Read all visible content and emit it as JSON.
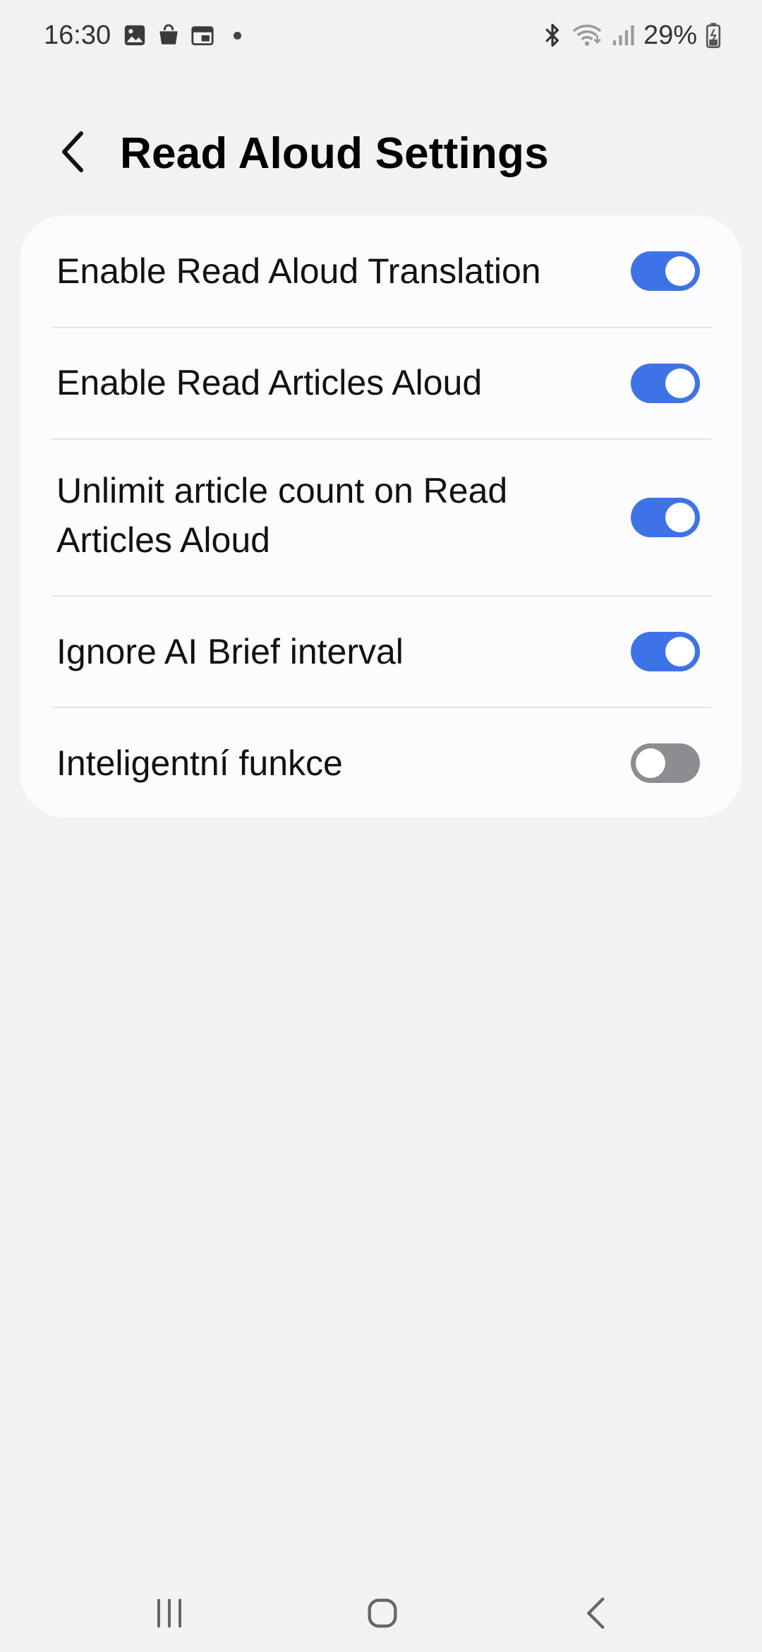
{
  "status_bar": {
    "time": "16:30",
    "battery_percent": "29%",
    "left_icons": [
      "gallery-icon",
      "shopping-bag-icon",
      "calendar-icon",
      "notification-dot-icon"
    ],
    "right_icons": [
      "bluetooth-icon",
      "wifi-icon",
      "signal-icon",
      "battery-charging-icon"
    ]
  },
  "header": {
    "title": "Read Aloud Settings",
    "back_icon": "chevron-left-icon"
  },
  "settings": [
    {
      "label": "Enable Read Aloud Translation",
      "enabled": true
    },
    {
      "label": "Enable Read Articles Aloud",
      "enabled": true
    },
    {
      "label": "Unlimit article count on Read Articles Aloud",
      "enabled": true
    },
    {
      "label": "Ignore AI Brief interval",
      "enabled": true
    },
    {
      "label": "Inteligentní funkce",
      "enabled": false
    }
  ],
  "colors": {
    "accent": "#3e73e8",
    "background": "#f2f2f4",
    "card": "#fcfcfe",
    "toggle_off": "#8d8d91"
  },
  "nav_bar": {
    "buttons": [
      "recent-apps-icon",
      "home-icon",
      "back-icon"
    ]
  }
}
